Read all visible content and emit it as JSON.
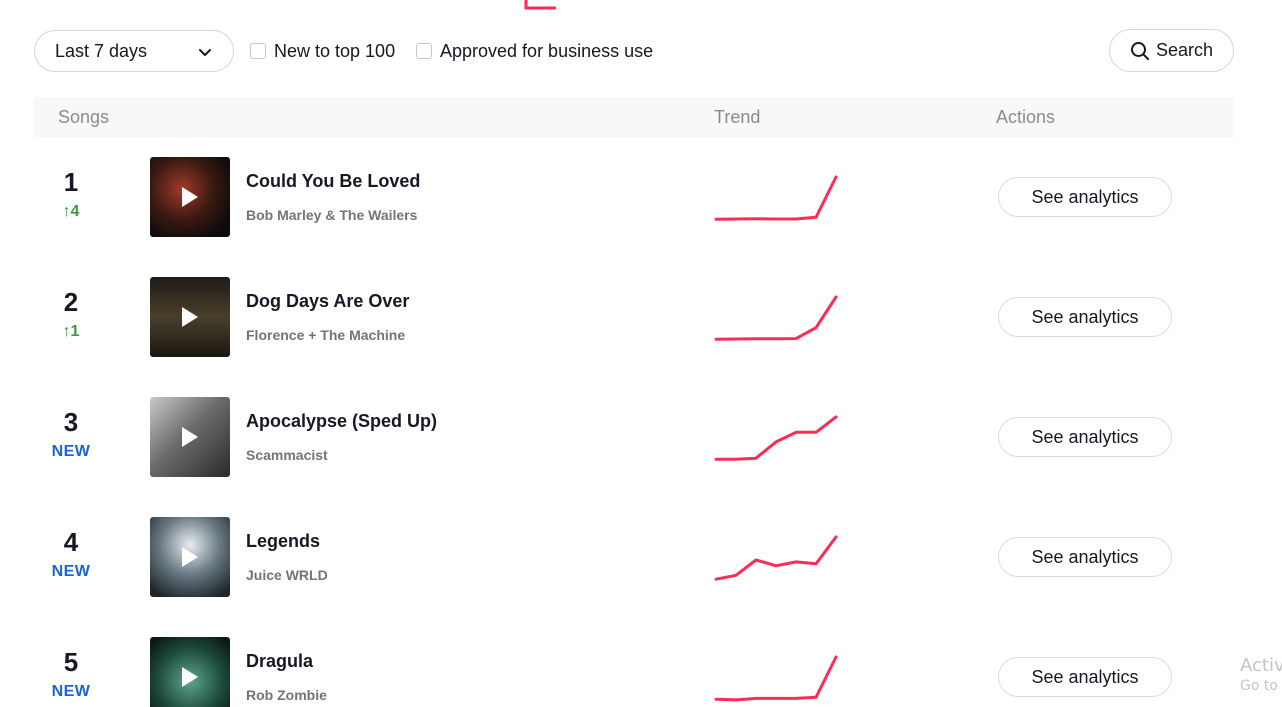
{
  "accent_color": "#fe2c55",
  "filters": {
    "period": "Last 7 days",
    "new_to_top": "New to top 100",
    "approved": "Approved for business use",
    "search": "Search"
  },
  "table": {
    "col_songs": "Songs",
    "col_trend": "Trend",
    "col_actions": "Actions"
  },
  "rows": [
    {
      "rank": "1",
      "change": "4",
      "change_type": "up",
      "title": "Could You Be Loved",
      "artist": "Bob Marley & The Wailers",
      "cover_icon": "album-cover",
      "trend": [
        2,
        2.1,
        2.2,
        2.1,
        2.1,
        3,
        24
      ],
      "action": "See analytics"
    },
    {
      "rank": "2",
      "change": "1",
      "change_type": "up",
      "title": "Dog Days Are Over",
      "artist": "Florence + The Machine",
      "cover_icon": "album-cover",
      "trend": [
        2,
        2.1,
        2.2,
        2.2,
        2.3,
        8,
        24
      ],
      "action": "See analytics"
    },
    {
      "rank": "3",
      "change": "NEW",
      "change_type": "new",
      "title": "Apocalypse (Sped Up)",
      "artist": "Scammacist",
      "cover_icon": "album-cover",
      "trend": [
        2,
        2,
        2.5,
        11,
        16,
        16,
        24
      ],
      "action": "See analytics"
    },
    {
      "rank": "4",
      "change": "NEW",
      "change_type": "new",
      "title": "Legends",
      "artist": "Juice WRLD",
      "cover_icon": "album-cover",
      "trend": [
        2,
        4,
        12,
        9,
        11,
        10,
        24
      ],
      "action": "See analytics"
    },
    {
      "rank": "5",
      "change": "NEW",
      "change_type": "new",
      "title": "Dragula",
      "artist": "Rob Zombie",
      "cover_icon": "album-cover",
      "trend": [
        2,
        1.6,
        2.4,
        2.4,
        2.4,
        3,
        24
      ],
      "action": "See analytics"
    }
  ],
  "watermark": {
    "line1": "Activ",
    "line2": "Go to"
  }
}
